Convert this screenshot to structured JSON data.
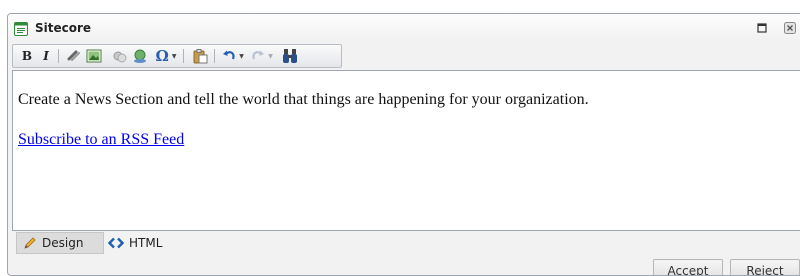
{
  "window": {
    "title": "Sitecore",
    "app_icon": "document-window-icon",
    "controls": [
      "maximize-icon",
      "close-icon"
    ]
  },
  "toolbar": {
    "bold_label": "B",
    "italic_label": "I",
    "insert_symbol_label": "Ω",
    "icons": [
      "bold-icon",
      "italic-icon",
      "insert-link-icon",
      "insert-image-icon",
      "insert-flash-icon",
      "remove-link-icon",
      "insert-symbol-icon",
      "paste-icon",
      "undo-icon",
      "redo-icon",
      "find-replace-icon"
    ]
  },
  "editor": {
    "paragraph": "Create a News Section and tell the world that things are happening for your organization.",
    "link_text": "Subscribe to an RSS Feed"
  },
  "mode_tabs": {
    "design_label": "Design",
    "html_label": "HTML",
    "active": "Design"
  },
  "actions": {
    "accept_label": "Accept",
    "reject_label": "Reject"
  },
  "colors": {
    "link": "#0000ee",
    "window_border": "#9fa6b1",
    "chrome_background": "#f2f2f2"
  }
}
